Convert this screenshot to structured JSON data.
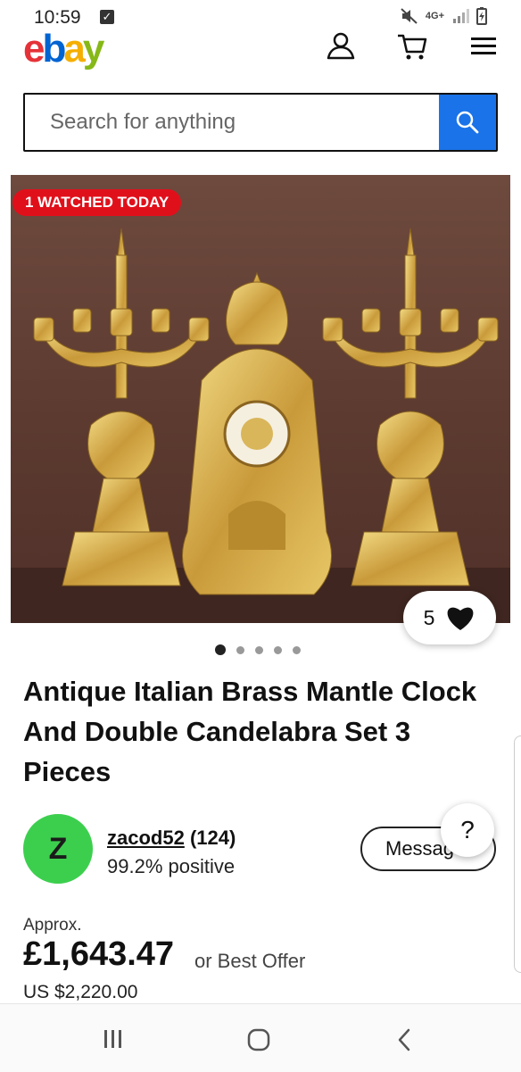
{
  "status_bar": {
    "time": "10:59",
    "network": "4G+"
  },
  "header": {
    "logo_letters": [
      "e",
      "b",
      "a",
      "y"
    ]
  },
  "search": {
    "placeholder": "Search for anything"
  },
  "listing": {
    "badge": "1 WATCHED TODAY",
    "watch_count": "5",
    "image_count": 5,
    "title": "Antique Italian Brass Mantle Clock And Double Candelabra Set 3 Pieces"
  },
  "seller": {
    "initial": "Z",
    "username": "zacod52",
    "feedback_count": "(124)",
    "positive": "99.2% positive",
    "message_label": "Message",
    "help_label": "?"
  },
  "price": {
    "approx_label": "Approx.",
    "amount": "£1,643.47",
    "offer_label": "or Best Offer",
    "usd": "US $2,220.00"
  },
  "colors": {
    "accent": "#1a73e8",
    "badge": "#e0101b",
    "avatar": "#3ccf4e"
  }
}
